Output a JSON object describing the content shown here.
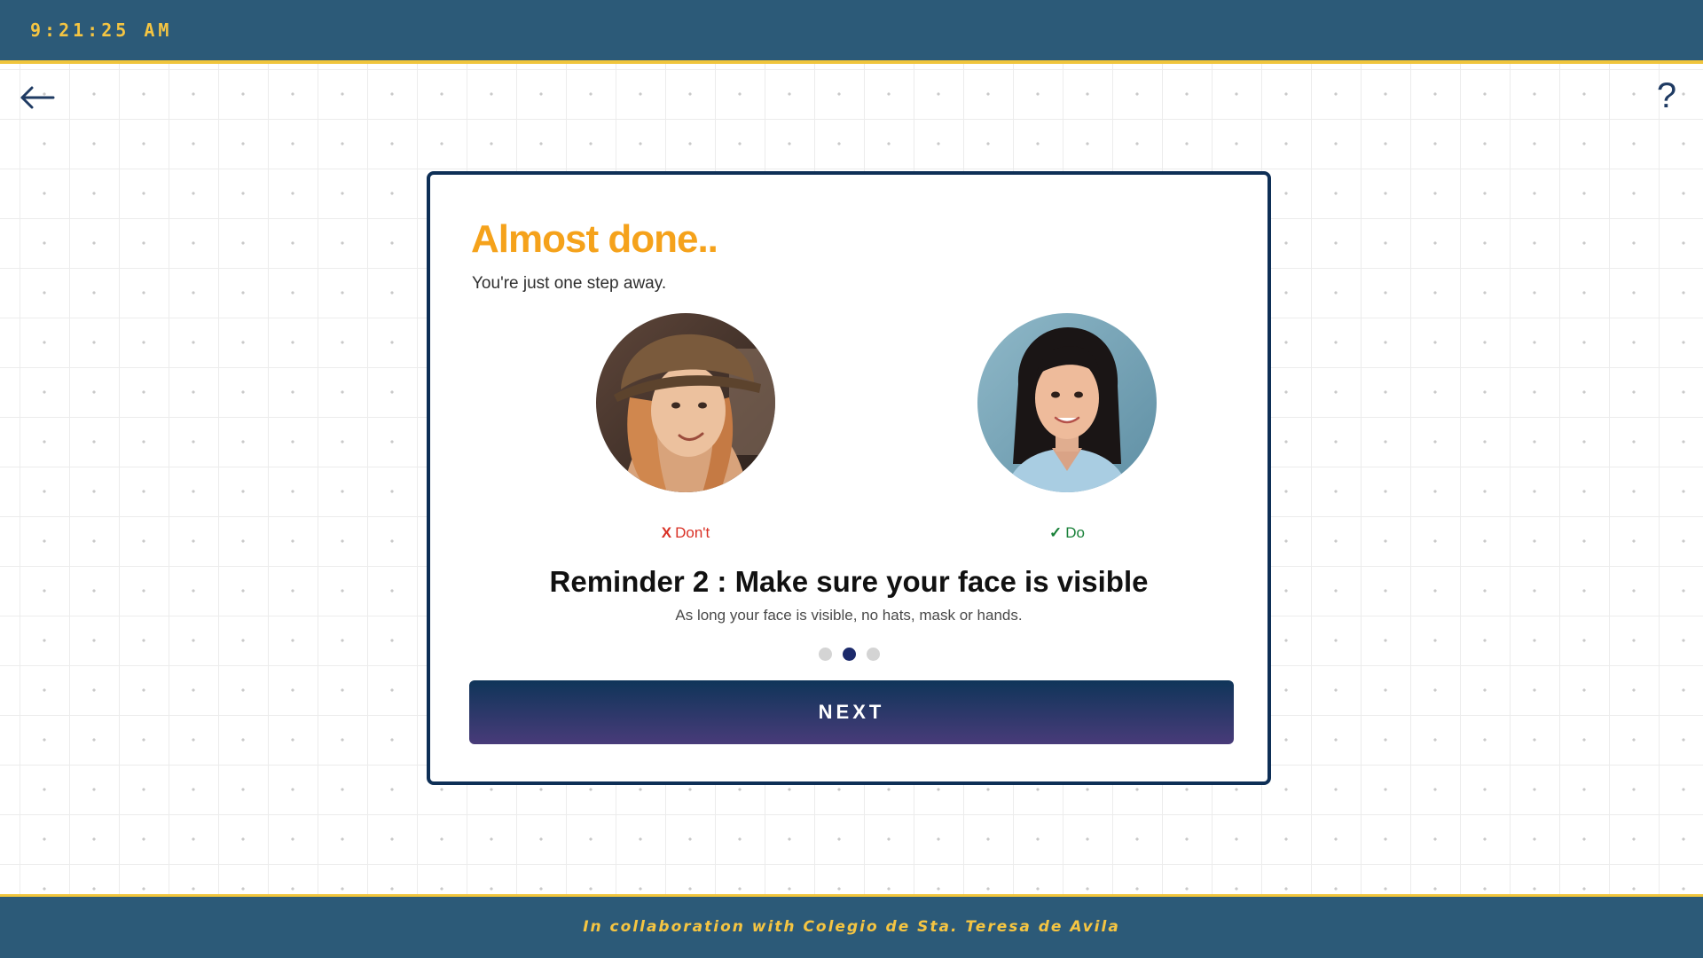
{
  "header": {
    "clock": "9:21:25 AM"
  },
  "nav": {
    "back_icon": "arrow-left-icon",
    "help_label": "?"
  },
  "card": {
    "title": "Almost done..",
    "subtitle": "You're just one step away.",
    "examples": [
      {
        "mark": "X",
        "label": "Don't",
        "color": "#d93025",
        "image": "woman-wearing-hat-photo"
      },
      {
        "mark": "✓",
        "label": "Do",
        "color": "#188038",
        "image": "woman-clear-face-photo"
      }
    ],
    "reminder_title": "Reminder 2 : Make sure your face is visible",
    "reminder_text": "As long your face is visible, no hats, mask or hands.",
    "pagination": {
      "total": 3,
      "current": 2
    },
    "next_label": "NEXT"
  },
  "footer": {
    "text": "In collaboration with Colegio de Sta. Teresa de Avila"
  },
  "colors": {
    "header_bg": "#2c5a78",
    "accent_yellow": "#f5c542",
    "title_orange": "#f5a21b",
    "card_border": "#0e2f56",
    "button_gradient_top": "#0f3559",
    "button_gradient_bottom": "#483b79",
    "active_dot": "#1c2a6b"
  }
}
